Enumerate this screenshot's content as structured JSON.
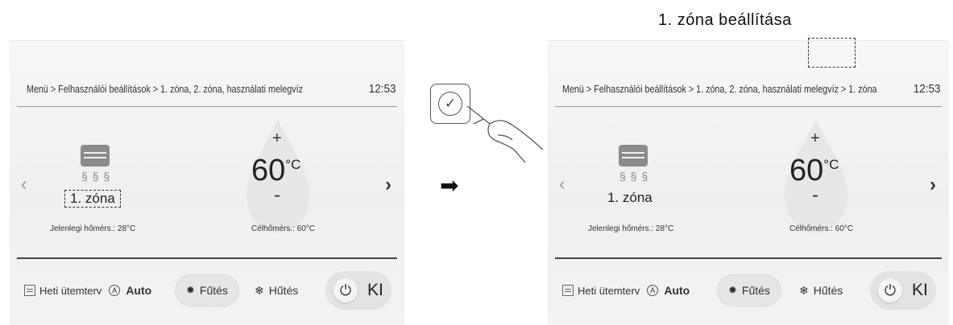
{
  "heading": "1. zóna beállítása",
  "left_panel": {
    "breadcrumb": "Menü > Felhasználói beállítások > 1. zóna, 2. zóna, használati melegvíz",
    "clock": "12:53",
    "zone_label": "1. zóna",
    "current_temp_label": "Jelenlegi hőmérs.: 28°C",
    "target_value": "60",
    "target_unit": "°C",
    "plus": "+",
    "minus": "-",
    "target_temp_label": "Célhőmérs.: 60°C",
    "nav_prev": "‹",
    "nav_next": "›",
    "schedule_label": "Heti ütemterv",
    "auto_label": "Auto",
    "heating_label": "Fűtés",
    "cooling_label": "Hűtés",
    "power_label": "KI"
  },
  "right_panel": {
    "breadcrumb": "Menü > Felhasználói beállítások > 1. zóna, 2. zóna, használati melegvíz > 1. zóna",
    "clock": "12:53",
    "zone_label": "1. zóna",
    "current_temp_label": "Jelenlegi hőmérs.: 28°C",
    "target_value": "60",
    "target_unit": "°C",
    "plus": "+",
    "minus": "-",
    "target_temp_label": "Célhőmérs.: 60°C",
    "nav_prev": "‹",
    "nav_next": "›",
    "schedule_label": "Heti ütemterv",
    "auto_label": "Auto",
    "heating_label": "Fűtés",
    "cooling_label": "Hűtés",
    "power_label": "KI"
  },
  "icons": {
    "confirm": "checkmark-icon",
    "hand": "pointing-hand-icon",
    "transition": "right-arrow-icon",
    "radiator": "radiator-icon",
    "drop": "water-drop-icon",
    "schedule": "calendar-icon",
    "auto": "auto-mode-icon",
    "sun": "sun-icon",
    "snow": "snowflake-icon",
    "power": "power-icon"
  }
}
